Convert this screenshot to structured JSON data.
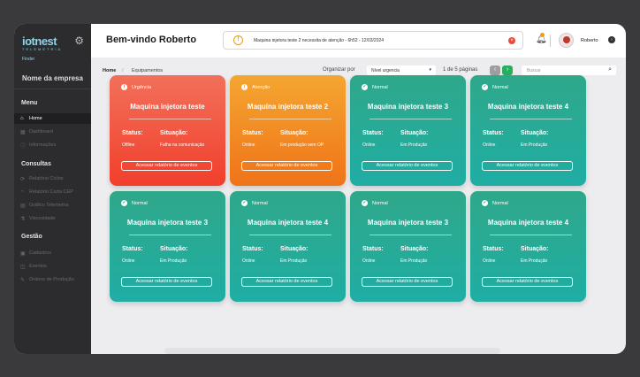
{
  "app": {
    "logo_text": "iotnest",
    "logo_sub": "TELEMETRIA",
    "logo_small": "Finder",
    "company": "Nome da empresa"
  },
  "sidebar": {
    "menu_title": "Menu",
    "menu_items": [
      {
        "label": "Home",
        "icon": "home-icon",
        "glyph": "⌂"
      },
      {
        "label": "Dashboard",
        "icon": "dashboard-icon",
        "glyph": "▦"
      },
      {
        "label": "Informações",
        "icon": "info-icon",
        "glyph": "ⓘ"
      }
    ],
    "consultas_title": "Consultas",
    "consultas_items": [
      {
        "label": "Relatório Ciclos",
        "icon": "cycle-report-icon",
        "glyph": "⟳"
      },
      {
        "label": "Relatório Carta CEP",
        "icon": "cep-chart-report-icon",
        "glyph": "◔"
      },
      {
        "label": "Gráfico Telemetria",
        "icon": "telemetry-chart-icon",
        "glyph": "▤"
      },
      {
        "label": "Viscosidade",
        "icon": "viscosity-icon",
        "glyph": "⚗"
      }
    ],
    "gestao_title": "Gestão",
    "gestao_items": [
      {
        "label": "Cadastros",
        "icon": "registers-icon",
        "glyph": "▣"
      },
      {
        "label": "Eventos",
        "icon": "events-icon",
        "glyph": "◫"
      },
      {
        "label": "Ordens de Produção",
        "icon": "production-orders-icon",
        "glyph": "✎"
      }
    ],
    "active_item": "Home"
  },
  "header": {
    "welcome": "Bem-vindo Roberto",
    "alert_text": "Maquina injetora teste 2 necessita de atenção - 6h52 - 12/03/2024",
    "user_name": "Roberto"
  },
  "toolbar": {
    "crumb_home": "Home",
    "crumb_sep": "/",
    "crumb_current": "Equipamentos",
    "sort_label": "Organizar por",
    "sort_value": "Nível urgencia",
    "page_info": "1 de 5 páginas",
    "search_placeholder": "Buscar"
  },
  "labels": {
    "status": "Status:",
    "situacao": "Situação:",
    "button": "Acessar relatório de eventos"
  },
  "colors": {
    "urgent": "#f13f2c",
    "warning": "#f07318",
    "normal": "#1fada4",
    "pagination_next": "#27ae60"
  },
  "cards": [
    {
      "level": "Urgência",
      "kind": "urgent",
      "title": "Maquina injetora teste",
      "status": "Offline",
      "situacao": "Falha na comunicação"
    },
    {
      "level": "Atenção",
      "kind": "warning",
      "title": "Maquina injetora teste 2",
      "status": "Online",
      "situacao": "Em produção sem OP"
    },
    {
      "level": "Normal",
      "kind": "normal",
      "title": "Maquina injetora teste 3",
      "status": "Online",
      "situacao": "Em Produção"
    },
    {
      "level": "Normal",
      "kind": "normal",
      "title": "Maquina injetora teste 4",
      "status": "Online",
      "situacao": "Em Produção"
    },
    {
      "level": "Normal",
      "kind": "normal",
      "title": "Maquina injetora teste 3",
      "status": "Online",
      "situacao": "Em Produção"
    },
    {
      "level": "Normal",
      "kind": "normal",
      "title": "Maquina injetora teste 4",
      "status": "Online",
      "situacao": "Em Produção"
    },
    {
      "level": "Normal",
      "kind": "normal",
      "title": "Maquina injetora teste 3",
      "status": "Online",
      "situacao": "Em Produção"
    },
    {
      "level": "Normal",
      "kind": "normal",
      "title": "Maquina injetora teste 4",
      "status": "Online",
      "situacao": "Em Produção"
    }
  ]
}
